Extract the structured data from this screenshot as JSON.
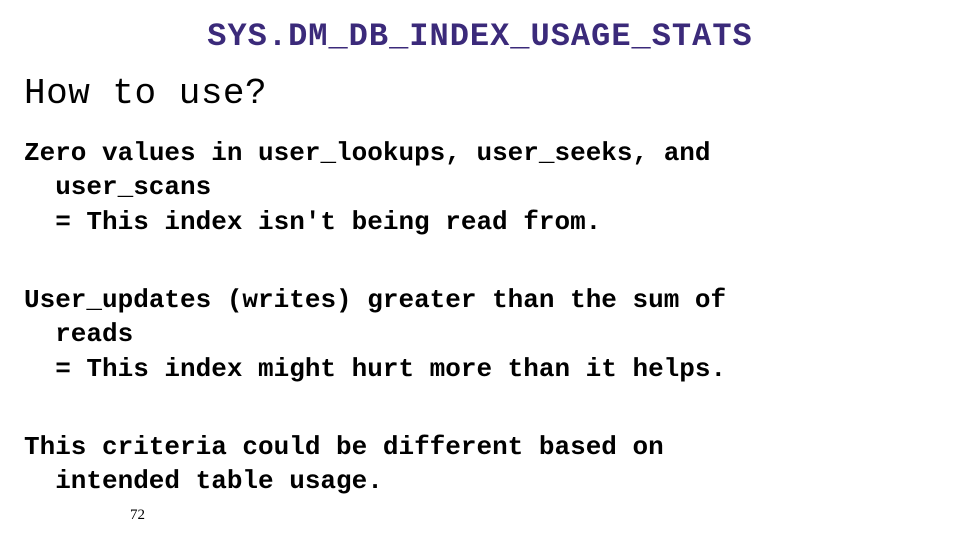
{
  "slide": {
    "title": "SYS.DM_DB_INDEX_USAGE_STATS",
    "subheading": "How to use?",
    "paragraphs": [
      {
        "line1": "Zero values in user_lookups, user_seeks, and",
        "line2": "user_scans",
        "line3": "= This index isn't being read from."
      },
      {
        "line1": "User_updates (writes) greater than the sum of",
        "line2": "reads",
        "line3": "= This index might hurt more than it helps."
      },
      {
        "line1": "This criteria could be different based on",
        "line2": "intended table usage."
      }
    ],
    "page_number": "72"
  }
}
